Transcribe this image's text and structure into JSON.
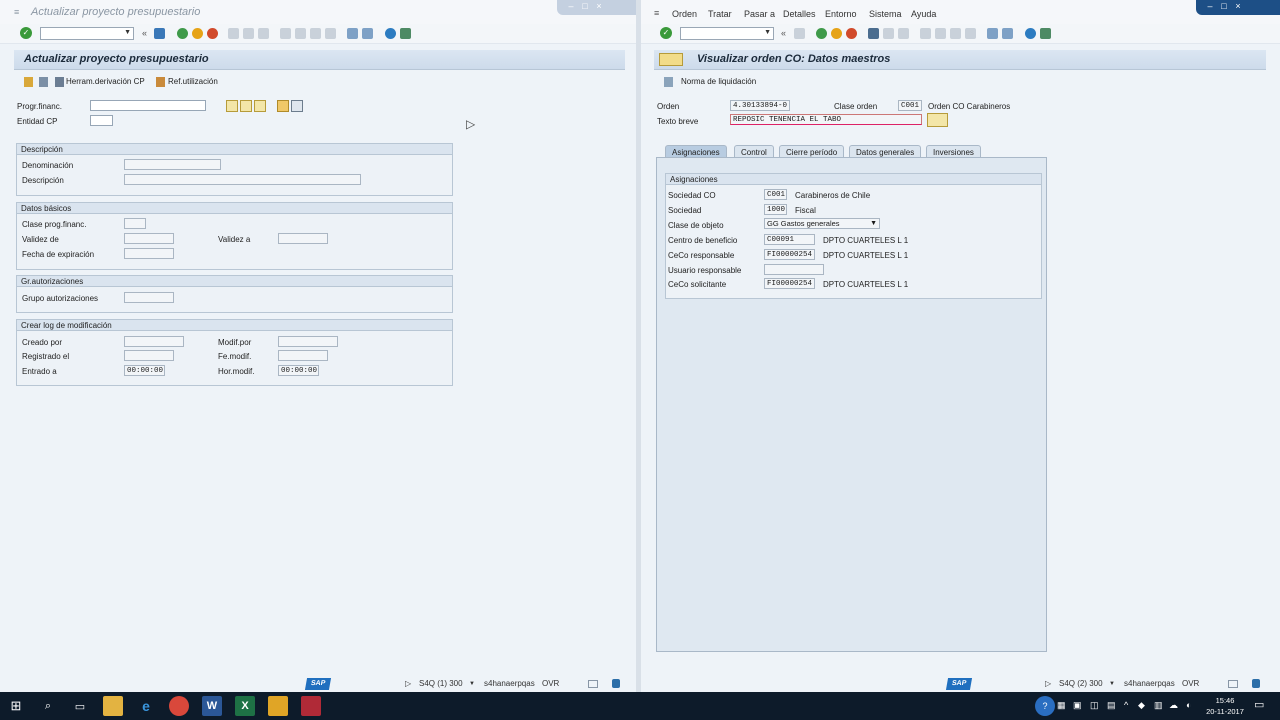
{
  "left": {
    "window_title": "Actualizar proyecto presupuestario",
    "screen_title": "Actualizar proyecto presupuestario",
    "app_buttons": [
      "Herram.derivación CP",
      "Ref.utilización"
    ],
    "fields": {
      "progr_financ": {
        "label": "Progr.financ.",
        "value": ""
      },
      "entidad_cp": {
        "label": "Entidad CP",
        "value": ""
      }
    },
    "groups": {
      "descripcion": {
        "title": "Descripción",
        "denominacion": "Denominación",
        "descripcion": "Descripción"
      },
      "datos_basicos": {
        "title": "Datos básicos",
        "clase": "Clase prog.financ.",
        "validez_de": "Validez de",
        "validez_a": "Validez a",
        "fecha_exp": "Fecha de expiración"
      },
      "autorizaciones": {
        "title": "Gr.autorizaciones",
        "grupo": "Grupo autorizaciones"
      },
      "log": {
        "title": "Crear log de modificación",
        "creado_por": "Creado por",
        "modif_por": "Modif.por",
        "registrado_el": "Registrado el",
        "fe_modif": "Fe.modif.",
        "entrado_a": "Entrado a",
        "entrado_a_value": "00:00:00",
        "hor_modif": "Hor.modif.",
        "hor_modif_value": "00:00:00"
      }
    },
    "status": {
      "system": "S4Q (1) 300",
      "server": "s4hanaerpqas",
      "mode": "OVR"
    }
  },
  "right": {
    "menu": [
      "Orden",
      "Tratar",
      "Pasar a",
      "Detalles",
      "Entorno",
      "Sistema",
      "Ayuda"
    ],
    "screen_title": "Visualizar orden CO: Datos maestros",
    "app_buttons": [
      "Norma de liquidación"
    ],
    "header": {
      "orden_label": "Orden",
      "orden_value": "4.30133894-0",
      "clase_label": "Clase orden",
      "clase_value": "C001",
      "clase_text": "Orden CO Carabineros",
      "texto_label": "Texto breve",
      "texto_value": "REPOSIC TENENCIA EL TABO"
    },
    "tabs": [
      "Asignaciones",
      "Control",
      "Cierre período",
      "Datos generales",
      "Inversiones"
    ],
    "assign": {
      "title": "Asignaciones",
      "rows": [
        {
          "label": "Sociedad CO",
          "value": "C001",
          "text": "Carabineros de Chile"
        },
        {
          "label": "Sociedad",
          "value": "1000",
          "text": "Fiscal"
        },
        {
          "label": "Clase de objeto",
          "value": "GG Gastos generales",
          "text": ""
        },
        {
          "label": "Centro de beneficio",
          "value": "C00091",
          "text": "DPTO CUARTELES L 1"
        },
        {
          "label": "CeCo responsable",
          "value": "FI00000254",
          "text": "DPTO CUARTELES L 1"
        },
        {
          "label": "Usuario responsable",
          "value": "",
          "text": ""
        },
        {
          "label": "CeCo solicitante",
          "value": "FI00000254",
          "text": "DPTO CUARTELES L 1"
        }
      ]
    },
    "status": {
      "system": "S4Q (2) 300",
      "server": "s4hanaerpqas",
      "mode": "OVR"
    }
  },
  "sap_logo": "SAP",
  "taskbar": {
    "time": "15:46",
    "date": "20-11-2017"
  },
  "colors": {
    "accent": "#1f6fbf",
    "taskbar": "#0d1b2a",
    "header": "#cddbeb"
  }
}
